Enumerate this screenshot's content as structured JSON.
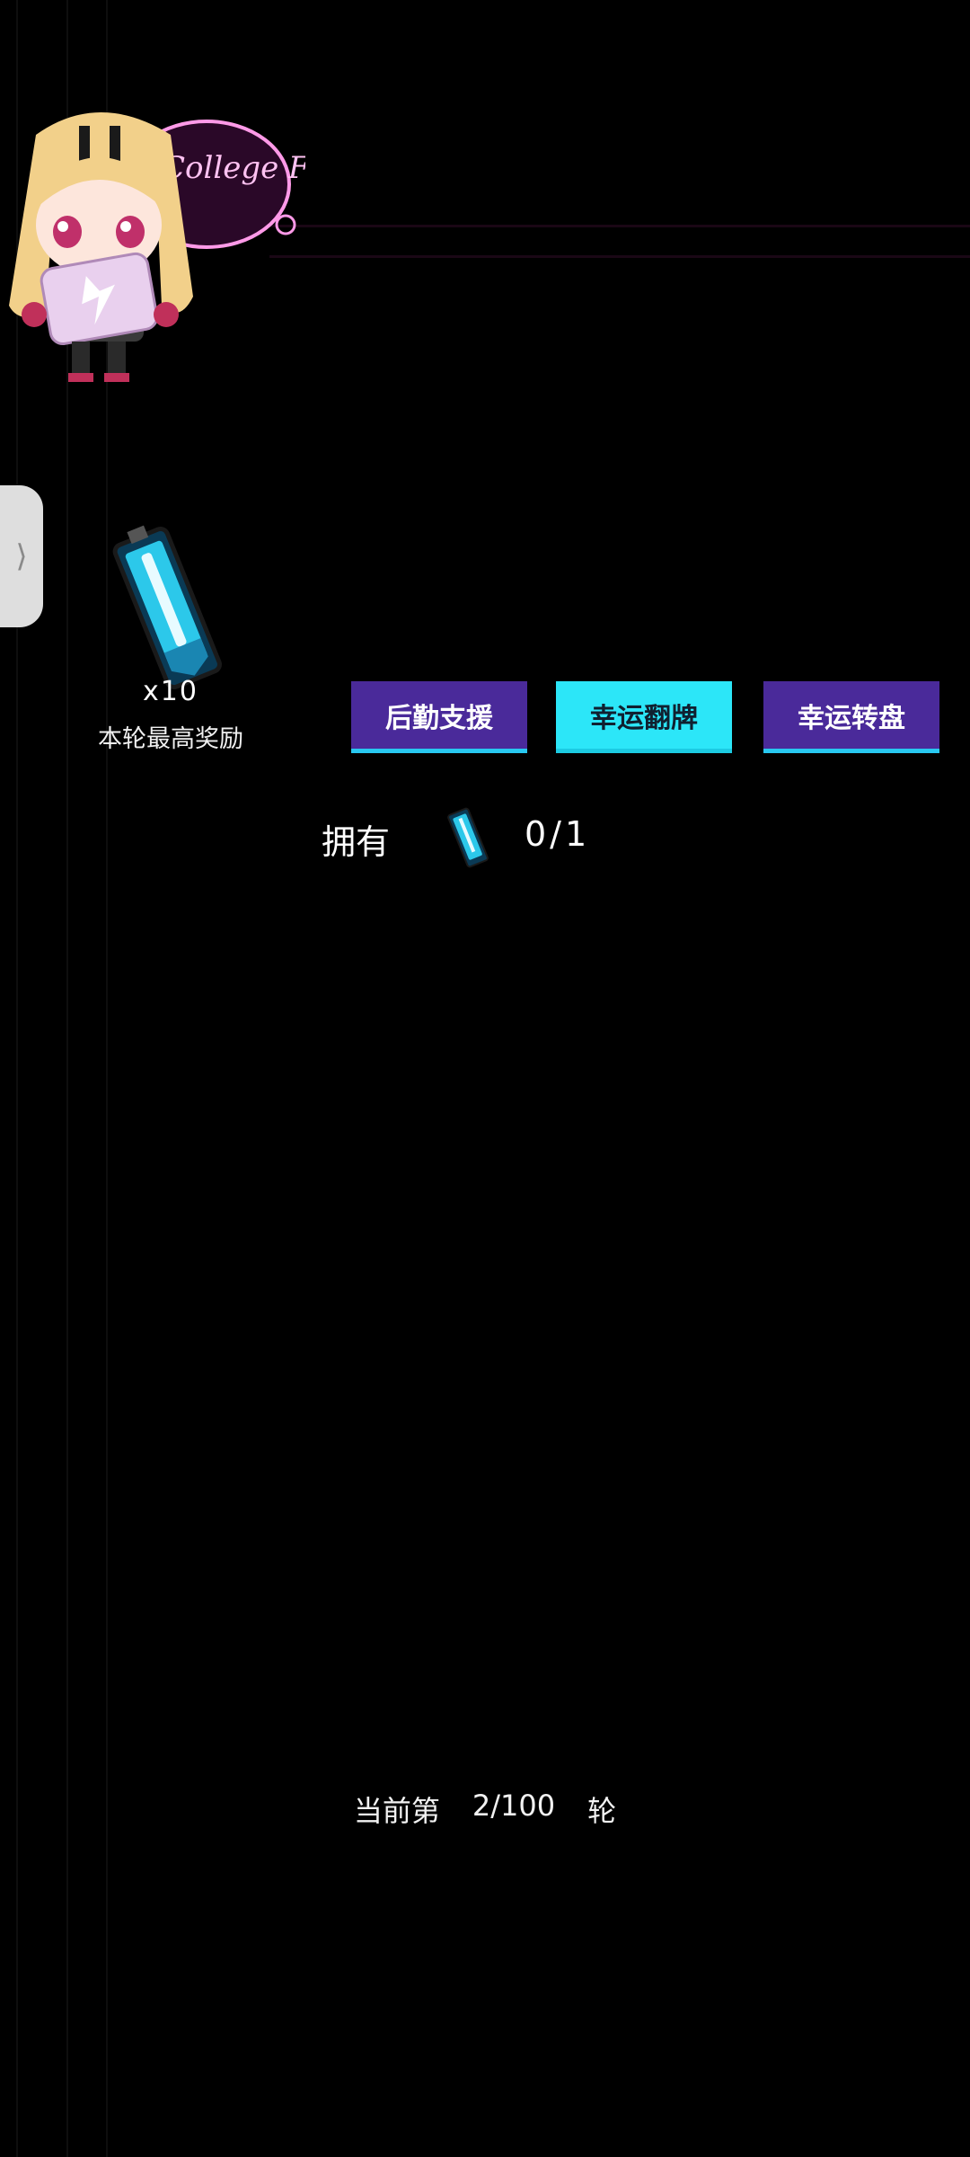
{
  "colors": {
    "background": "#000000",
    "tab_inactive": "#4a2a9a",
    "tab_active": "#2ce6f8",
    "tab_underline": "#28c8f0"
  },
  "mascot": {
    "logo_text": "College Fighting",
    "icon": "mascot-girl-logo"
  },
  "side_tab": {
    "glyph": "⟩"
  },
  "reward": {
    "icon": "energy-card-icon",
    "count": "x10",
    "label": "本轮最高奖励"
  },
  "tabs": [
    {
      "label": "后勤支援",
      "active": false
    },
    {
      "label": "幸运翻牌",
      "active": true
    },
    {
      "label": "幸运转盘",
      "active": false
    }
  ],
  "owned": {
    "label": "拥有",
    "icon": "energy-card-icon",
    "count": "0/1"
  },
  "round": {
    "prefix": "当前第",
    "value": "2/100",
    "suffix": "轮"
  }
}
